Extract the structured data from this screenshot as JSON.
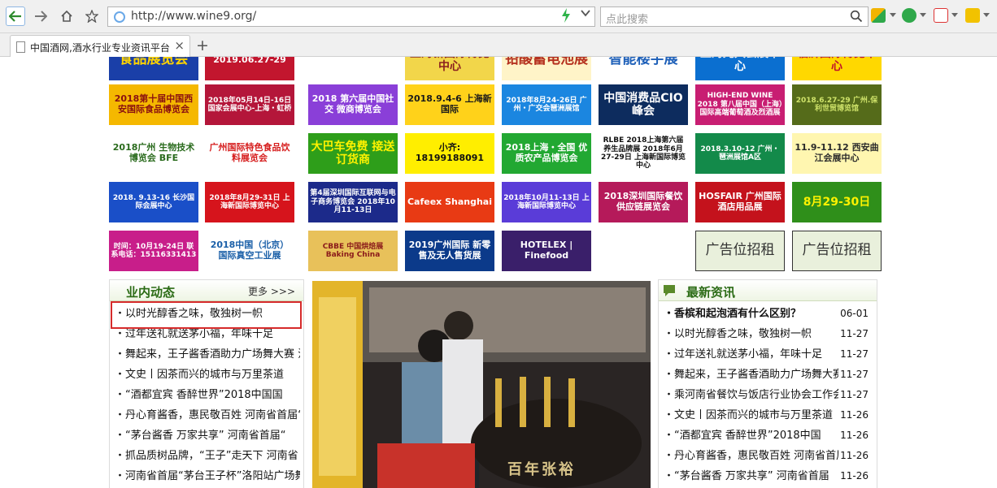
{
  "browser": {
    "url": "http://www.wine9.org/",
    "search_placeholder": "点此搜索",
    "tab_title": "中国酒网,酒水行业专业资讯平台",
    "tab_close": "×",
    "new_tab": "+"
  },
  "ads": [
    {
      "text": "食品展览会",
      "bg": "#1a3fa8",
      "fg": "#ffd400"
    },
    {
      "text": "2019.06.27-29",
      "bg": "#c2162e",
      "fg": "#ffffff"
    },
    {
      "text": "",
      "bg": "#ffffff",
      "fg": "#1aa3d8"
    },
    {
      "text": "上海新国际博览中心",
      "bg": "#f2d64a",
      "fg": "#8a1f1f"
    },
    {
      "text": "铅酸蓄电池展",
      "bg": "#fff4c8",
      "fg": "#b5311f"
    },
    {
      "text": "智能楼宇展",
      "bg": "#ffffff",
      "fg": "#1d5fb8"
    },
    {
      "text": "上海光大会展中心",
      "bg": "#0b6fd0",
      "fg": "#ffffff"
    },
    {
      "text": "临沂国际博览中心",
      "bg": "#ffd800",
      "fg": "#c0132a"
    },
    {
      "text": "2018第十届中国西安国际食品博览会",
      "bg": "#f5b800",
      "fg": "#8a1010"
    },
    {
      "text": "2018年05月14日-16日 国家会展中心-上海・虹桥",
      "bg": "#b4163a",
      "fg": "#ffffff"
    },
    {
      "text": "2018 第六届中国社交 微商博览会",
      "bg": "#8a3fd8",
      "fg": "#ffffff"
    },
    {
      "text": "2018.9.4-6 上海新国际",
      "bg": "#ffd21a",
      "fg": "#1a1a1a"
    },
    {
      "text": "2018年8月24-26日 广州・广交会琶洲展馆",
      "bg": "#1b86e0",
      "fg": "#ffffff"
    },
    {
      "text": "中国消费品CIO峰会",
      "bg": "#0d2c5e",
      "fg": "#ffffff"
    },
    {
      "text": "HIGH-END WINE 2018 第八届中国（上海）国际高端葡萄酒及烈酒展",
      "bg": "#c81e72",
      "fg": "#ffffff"
    },
    {
      "text": "2018.6.27-29 广州.保利世贸博览馆",
      "bg": "#556b1a",
      "fg": "#cfe36a"
    },
    {
      "text": "2018广州 生物技术博览会 BFE",
      "bg": "#ffffff",
      "fg": "#2a6b1d"
    },
    {
      "text": "广州国际特色食品饮料展览会",
      "bg": "#ffffff",
      "fg": "#d61d1d"
    },
    {
      "text": "大巴车免费 接送订货商",
      "bg": "#2e9e1a",
      "fg": "#fff200"
    },
    {
      "text": "小齐: 18199188091",
      "bg": "#ffee00",
      "fg": "#111111"
    },
    {
      "text": "2018上海・全国 优质农产品博览会",
      "bg": "#22a832",
      "fg": "#ffffff"
    },
    {
      "text": "RLBE 2018上海第六届 养生品牌展 2018年6月27-29日 上海新国际博览中心",
      "bg": "#ffffff",
      "fg": "#111111"
    },
    {
      "text": "2018.3.10-12 广州・琶洲展馆A区",
      "bg": "#138a4a",
      "fg": "#ffffff"
    },
    {
      "text": "11.9-11.12 西安曲江会展中心",
      "bg": "#fff6b0",
      "fg": "#2a2a2a"
    },
    {
      "text": "2018. 9.13-16 长沙国际会展中心",
      "bg": "#1a4fc8",
      "fg": "#ffffff"
    },
    {
      "text": "2018年8月29-31日 上海新国际博览中心",
      "bg": "#d6141c",
      "fg": "#ffffff"
    },
    {
      "text": "第4届深圳国际互联网与电子商务博览会 2018年10月11-13日",
      "bg": "#1c2a8a",
      "fg": "#ffffff"
    },
    {
      "text": "Cafeex Shanghai",
      "bg": "#e83a14",
      "fg": "#ffffff"
    },
    {
      "text": "2018年10月11-13日 上海新国际博览中心",
      "bg": "#5a3cd8",
      "fg": "#ffffff"
    },
    {
      "text": "2018深圳国际餐饮 供应链展览会",
      "bg": "#b51a5a",
      "fg": "#ffffff"
    },
    {
      "text": "HOSFAIR 广州国际酒店用品展",
      "bg": "#c4121c",
      "fg": "#ffffff"
    },
    {
      "text": "8月29-30日",
      "bg": "#2f8f1a",
      "fg": "#fff200"
    },
    {
      "text": "时间：10月19-24日 联系电话：15116331413",
      "bg": "#c81e8a",
      "fg": "#ffffff"
    },
    {
      "text": "2018中国（北京） 国际真空工业展",
      "bg": "#ffffff",
      "fg": "#1a5fa8"
    },
    {
      "text": "CBBE 中国烘焙展 Baking China",
      "bg": "#e8c15a",
      "fg": "#8a1a1a"
    },
    {
      "text": "2019广州国际 新零售及无人售货展",
      "bg": "#0b3a8a",
      "fg": "#ffffff"
    },
    {
      "text": "HOTELEX | Finefood",
      "bg": "#3a1f6a",
      "fg": "#ffffff"
    },
    {
      "text": "",
      "bg": "#ffffff",
      "fg": "#d4a017"
    },
    {
      "text": "广告位招租",
      "bg": "#e9f0dc",
      "fg": "#333333"
    },
    {
      "text": "广告位招租",
      "bg": "#e9f0dc",
      "fg": "#333333"
    }
  ],
  "left_panel": {
    "title": "业内动态",
    "more": "更多 >>>",
    "items": [
      "・以时光醇香之味，敬独树一帜",
      "・过年送礼就送茅小福，年味十足",
      "・舞起来，王子酱香酒助力广场舞大赛 江",
      "・文史丨因茶而兴的城市与万里茶道",
      "・“酒都宜宾 香醉世界”2018中国国",
      "・丹心育酱香，惠民敬百姓 河南省首届“",
      "・“茅台酱香 万家共享” 河南省首届“",
      "・抓品质树品牌，“王子”走天下 河南省",
      "・河南省首届“茅台王子杯”洛阳站广场舞"
    ]
  },
  "photo": {
    "banner": "百年张裕"
  },
  "right_panel": {
    "title": "最新资讯",
    "items": [
      {
        "text": "・香槟和起泡酒有什么区别？",
        "date": "06-01",
        "bold": true
      },
      {
        "text": "・以时光醇香之味，敬独树一帜",
        "date": "11-27"
      },
      {
        "text": "・过年送礼就送茅小福，年味十足",
        "date": "11-27"
      },
      {
        "text": "・舞起来，王子酱香酒助力广场舞大赛",
        "date": "11-27"
      },
      {
        "text": "・乘河南省餐饮与饭店行业协会工作会议",
        "date": "11-27"
      },
      {
        "text": "・文史丨因茶而兴的城市与万里茶道",
        "date": "11-26"
      },
      {
        "text": "・“酒都宜宾 香醉世界”2018中国",
        "date": "11-26"
      },
      {
        "text": "・丹心育酱香，惠民敬百姓 河南省首届",
        "date": "11-26"
      },
      {
        "text": "・“茅台酱香 万家共享” 河南省首届",
        "date": "11-26"
      }
    ]
  },
  "colors": {
    "accent_green": "#2b6b15",
    "highlight_red": "#d62b2b"
  }
}
